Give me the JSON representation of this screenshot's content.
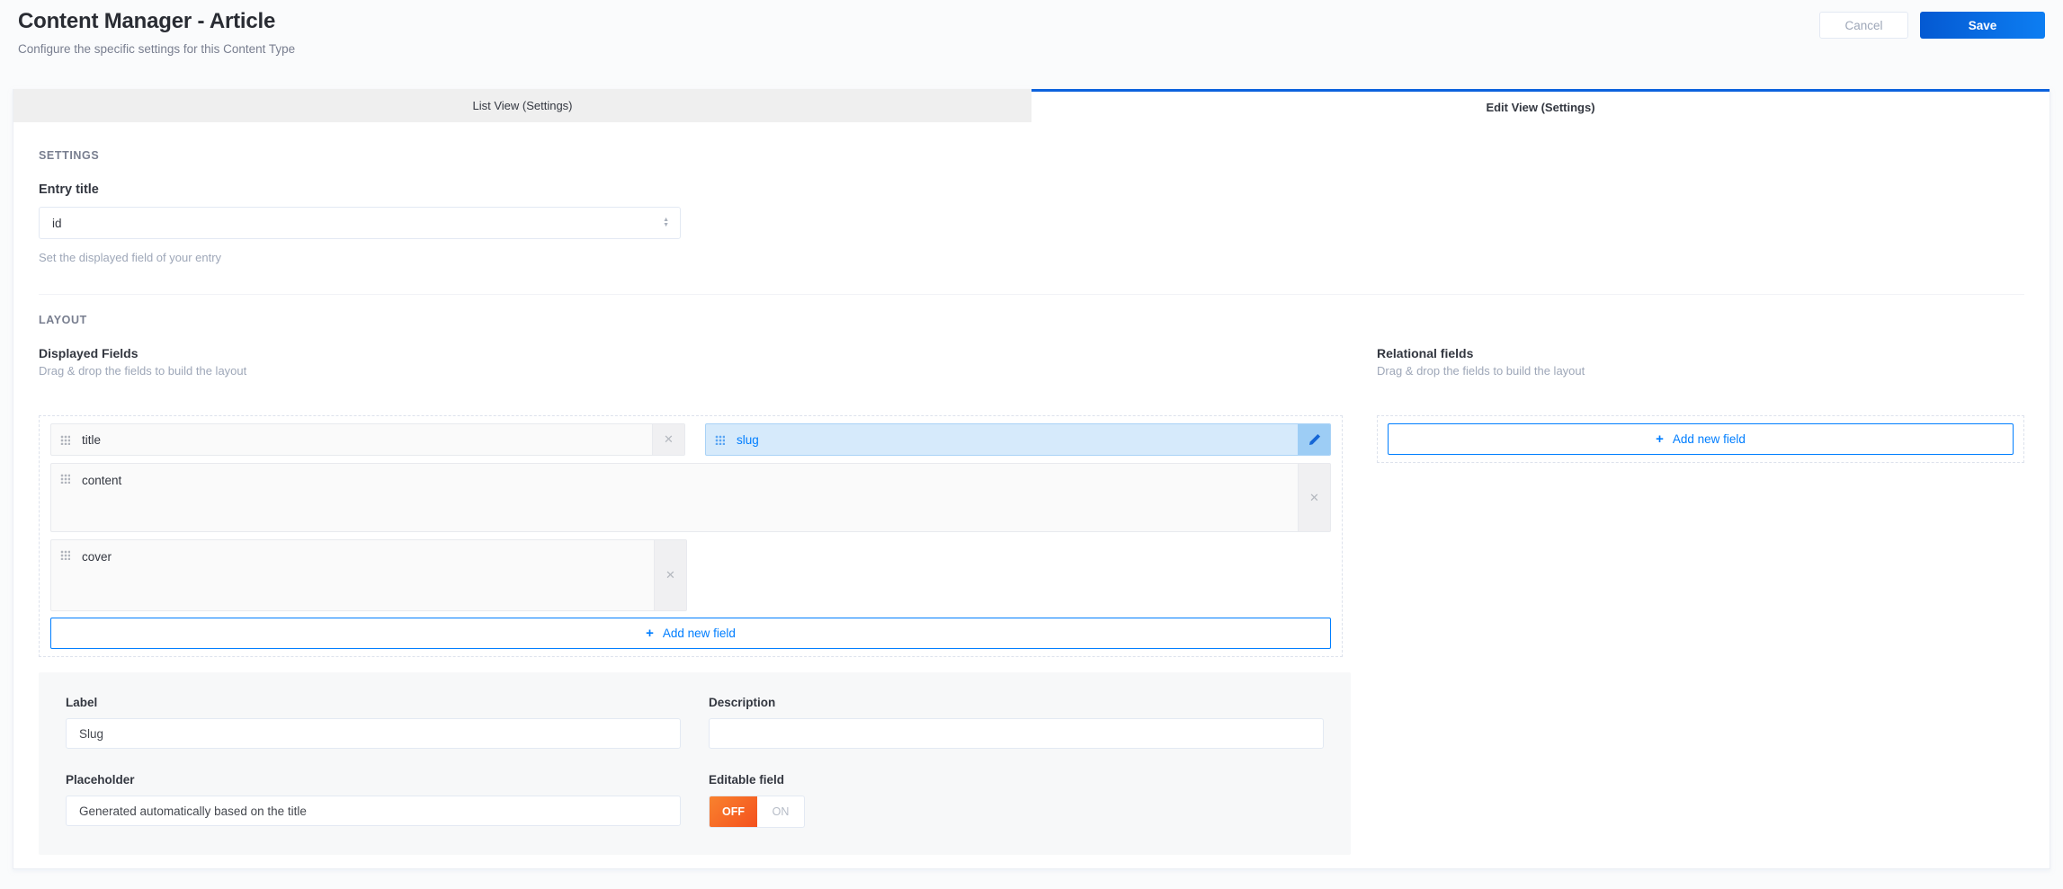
{
  "header": {
    "title": "Content Manager - Article",
    "subtitle": "Configure the specific settings for this Content Type",
    "cancel_label": "Cancel",
    "save_label": "Save"
  },
  "tabs": [
    {
      "label": "List View (Settings)",
      "active": false
    },
    {
      "label": "Edit View (Settings)",
      "active": true
    }
  ],
  "settings": {
    "section_label": "SETTINGS",
    "entry_title_label": "Entry title",
    "entry_title_value": "id",
    "entry_title_help": "Set the displayed field of your entry"
  },
  "layout": {
    "section_label": "LAYOUT",
    "displayed_fields": {
      "title": "Displayed Fields",
      "subtitle": "Drag & drop the fields to build the layout",
      "fields": [
        {
          "name": "title",
          "selected": false
        },
        {
          "name": "slug",
          "selected": true
        },
        {
          "name": "content",
          "selected": false
        },
        {
          "name": "cover",
          "selected": false
        }
      ],
      "add_button_label": "Add new field"
    },
    "relational_fields": {
      "title": "Relational fields",
      "subtitle": "Drag & drop the fields to build the layout",
      "add_button_label": "Add new field"
    }
  },
  "field_form": {
    "label_label": "Label",
    "label_value": "Slug",
    "description_label": "Description",
    "description_value": "",
    "placeholder_label": "Placeholder",
    "placeholder_value": "Generated automatically based on the title",
    "editable_label": "Editable field",
    "toggle_off_label": "OFF",
    "toggle_on_label": "ON",
    "editable_value": "OFF"
  },
  "icons": {
    "close": "✕",
    "plus": "+",
    "stepper_up": "▲",
    "stepper_down": "▼"
  },
  "colors": {
    "accent_blue": "#007eff",
    "tab_active_border": "#0c62dd",
    "save_gradient_start": "#0459d2",
    "save_gradient_end": "#0d7ef2",
    "selected_chip_bg": "#d6eafb",
    "toggle_off_start": "#f9822e",
    "toggle_off_end": "#f4511e"
  }
}
